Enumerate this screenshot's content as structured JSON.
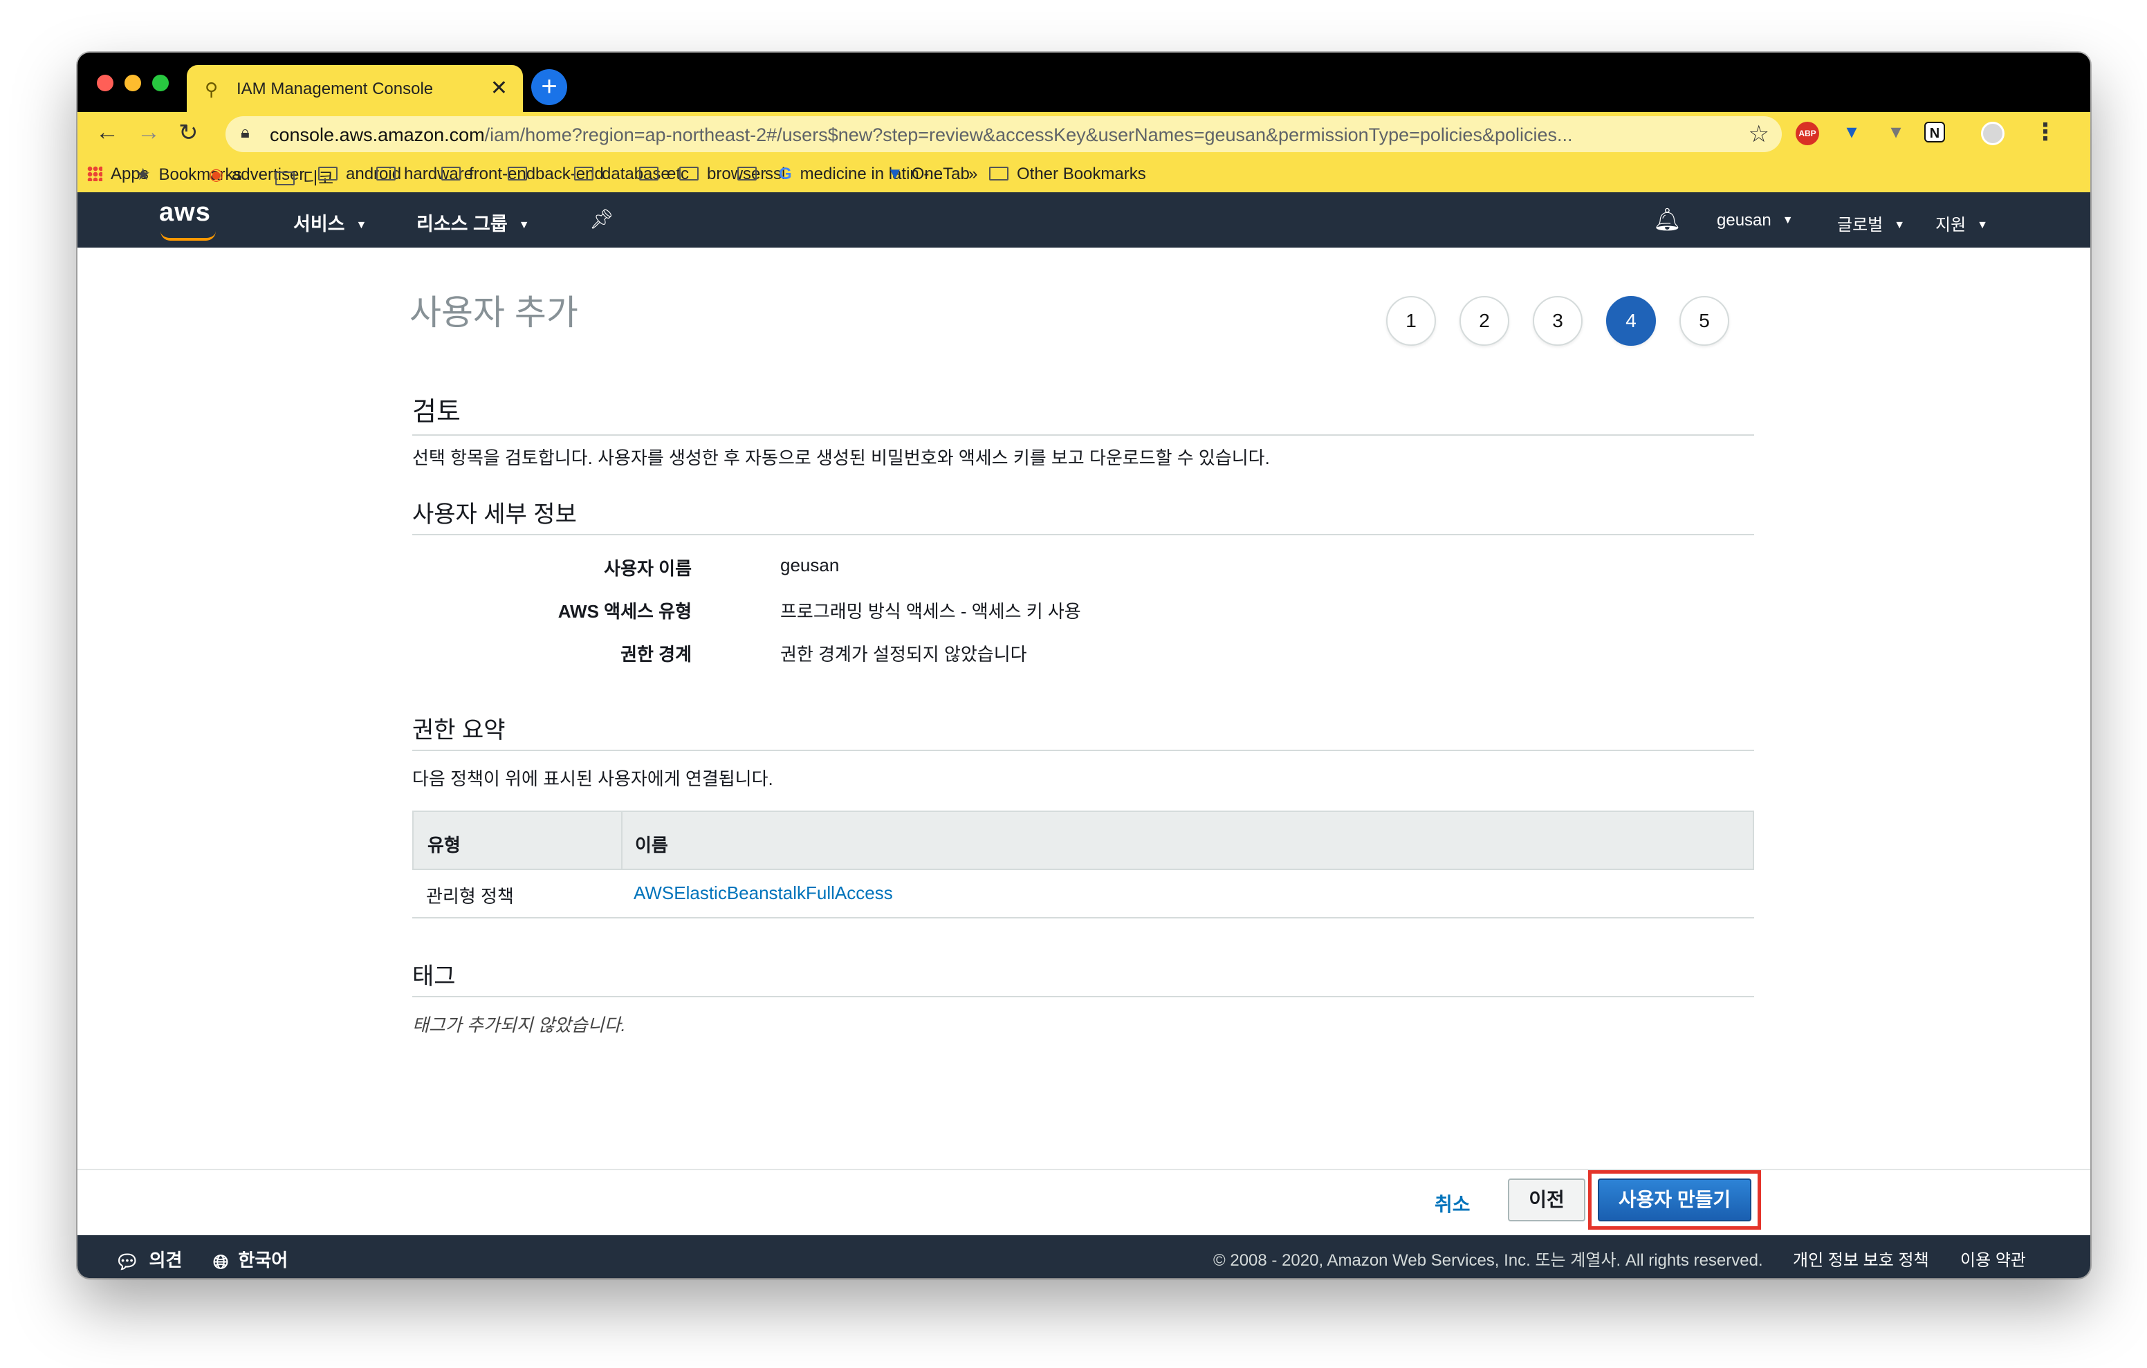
{
  "browser": {
    "tab_title": "IAM Management Console",
    "tab_close": "✕",
    "new_tab": "+",
    "url_host": "console.aws.amazon.com",
    "url_path": "/iam/home?region=ap-northeast-2#/users$new?step=review&accessKey&userNames=geusan&permissionType=policies&policies...",
    "ext_abp": "ABP",
    "ext_notion": "N",
    "bookmarks": [
      "Apps",
      "Bookmarks",
      "advertiser",
      "디코",
      "android",
      "hardware",
      "front-end",
      "back-end",
      "database",
      "etc",
      "browser",
      "ssl",
      "medicine in latin -...",
      "OneTab"
    ],
    "overflow": "»",
    "other_bookmarks": "Other Bookmarks"
  },
  "aws_nav": {
    "logo": "aws",
    "services": "서비스",
    "resource_groups": "리소스 그룹",
    "account": "geusan",
    "region": "글로벌",
    "support": "지원"
  },
  "page": {
    "title": "사용자 추가",
    "steps": [
      "1",
      "2",
      "3",
      "4",
      "5"
    ],
    "active_step": 4,
    "review_title": "검토",
    "review_desc": "선택 항목을 검토합니다. 사용자를 생성한 후 자동으로 생성된 비밀번호와 액세스 키를 보고 다운로드할 수 있습니다.",
    "user_details_title": "사용자 세부 정보",
    "details": {
      "username_label": "사용자 이름",
      "username_value": "geusan",
      "access_type_label": "AWS 액세스 유형",
      "access_type_value": "프로그래밍 방식 액세스 - 액세스 키 사용",
      "boundary_label": "권한 경계",
      "boundary_value": "권한 경계가 설정되지 않았습니다"
    },
    "permissions_title": "권한 요약",
    "permissions_desc": "다음 정책이 위에 표시된 사용자에게 연결됩니다.",
    "table": {
      "headers": [
        "유형",
        "이름"
      ],
      "rows": [
        {
          "type": "관리형 정책",
          "name": "AWSElasticBeanstalkFullAccess"
        }
      ]
    },
    "tags_title": "태그",
    "tags_empty": "태그가 추가되지 않았습니다.",
    "buttons": {
      "cancel": "취소",
      "previous": "이전",
      "create": "사용자 만들기"
    }
  },
  "footer": {
    "feedback": "의견",
    "language": "한국어",
    "copyright": "© 2008 - 2020, Amazon Web Services, Inc. 또는 계열사. All rights reserved.",
    "privacy": "개인 정보 보호 정책",
    "terms": "이용 약관"
  },
  "colors": {
    "accent": "#1f63b8",
    "link": "#0073bb",
    "aws_nav_bg": "#232f3e",
    "browser_theme": "#fbe04a",
    "highlight": "#e4342a"
  }
}
